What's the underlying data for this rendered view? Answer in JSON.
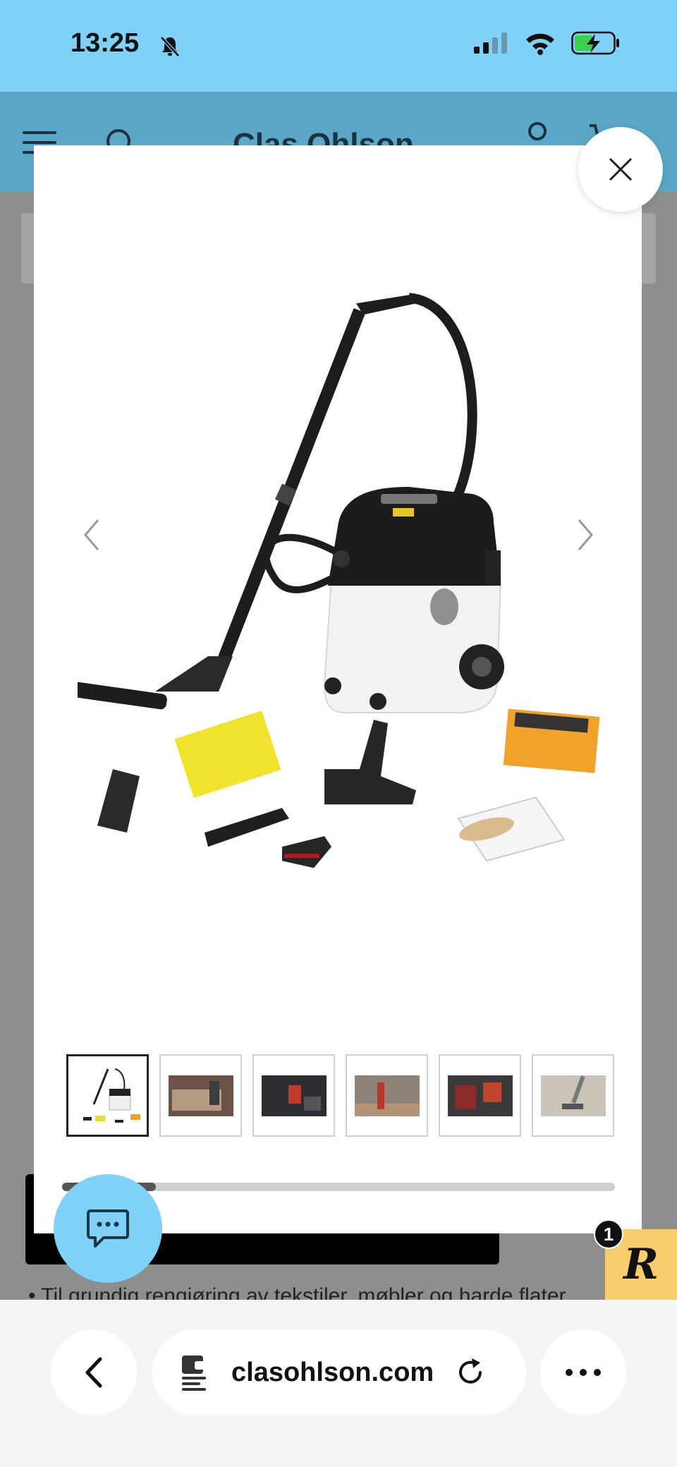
{
  "status_bar": {
    "time": "13:25",
    "icons": [
      "bell-slash-icon",
      "signal-icon",
      "wifi-icon",
      "battery-charging-icon"
    ]
  },
  "site": {
    "logo": "Clas Ohlson",
    "header_icons": [
      "menu-icon",
      "search-icon",
      "account-icon",
      "cart-icon"
    ],
    "bullet_text": "Til grundig rengjøring av tekstiler, møbler og harde flater"
  },
  "gallery": {
    "thumbnail_count": 6,
    "active_index": 0,
    "scroll_position": 0.17
  },
  "reward": {
    "badge_count": "1",
    "logo_letter": "R"
  },
  "browser": {
    "url": "clasohlson.com"
  },
  "colors": {
    "status_bar": "#7fd1f7",
    "header": "#5ba7c8",
    "chat_button": "#7fd1f7",
    "reward": "#f8cd6e"
  }
}
